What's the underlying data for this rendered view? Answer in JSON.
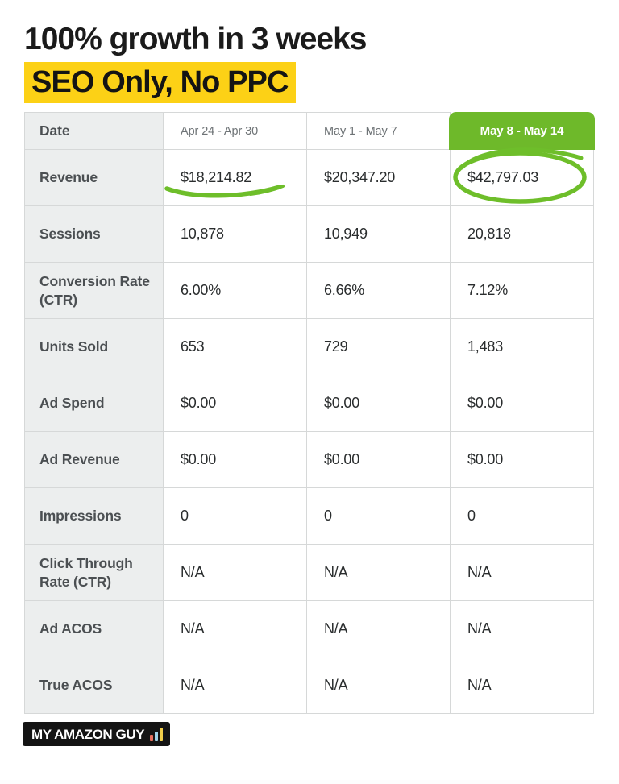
{
  "headline": {
    "line1": "100% growth in 3 weeks",
    "line2": "SEO Only, No PPC",
    "highlight_color": "#fcd116"
  },
  "table": {
    "label_column_header": "Date",
    "period_headers": [
      {
        "label": "Apr 24 - Apr 30",
        "highlighted": false
      },
      {
        "label": "May 1 - May 7",
        "highlighted": false
      },
      {
        "label": "May 8 - May 14",
        "highlighted": true
      }
    ],
    "highlight_color": "#6eb92a",
    "rows": [
      {
        "metric": "Revenue",
        "values": [
          "$18,214.82",
          "$20,347.20",
          "$42,797.03"
        ]
      },
      {
        "metric": "Sessions",
        "values": [
          "10,878",
          "10,949",
          "20,818"
        ]
      },
      {
        "metric": "Conversion Rate (CTR)",
        "values": [
          "6.00%",
          "6.66%",
          "7.12%"
        ]
      },
      {
        "metric": "Units Sold",
        "values": [
          "653",
          "729",
          "1,483"
        ]
      },
      {
        "metric": "Ad Spend",
        "values": [
          "$0.00",
          "$0.00",
          "$0.00"
        ]
      },
      {
        "metric": "Ad Revenue",
        "values": [
          "$0.00",
          "$0.00",
          "$0.00"
        ]
      },
      {
        "metric": "Impressions",
        "values": [
          "0",
          "0",
          "0"
        ]
      },
      {
        "metric": "Click Through Rate (CTR)",
        "values": [
          "N/A",
          "N/A",
          "N/A"
        ]
      },
      {
        "metric": "Ad ACOS",
        "values": [
          "N/A",
          "N/A",
          "N/A"
        ]
      },
      {
        "metric": "True ACOS",
        "values": [
          "N/A",
          "N/A",
          "N/A"
        ]
      }
    ]
  },
  "annotations": {
    "underline_target": "$18,214.82",
    "circle_target": "$42,797.03",
    "ink_color": "#6ebe2a"
  },
  "logo": {
    "text": "MY AMAZON GUY",
    "bar_colors": [
      "#e8705f",
      "#9fd2e8",
      "#f2cf4a"
    ]
  },
  "chart_data": {
    "type": "table",
    "title": "100% growth in 3 weeks — SEO Only, No PPC",
    "categories": [
      "Apr 24 - Apr 30",
      "May 1 - May 7",
      "May 8 - May 14"
    ],
    "series": [
      {
        "name": "Revenue",
        "values": [
          18214.82,
          20347.2,
          42797.03
        ]
      },
      {
        "name": "Sessions",
        "values": [
          10878,
          10949,
          20818
        ]
      },
      {
        "name": "Conversion Rate (CTR)",
        "values": [
          6.0,
          6.66,
          7.12
        ]
      },
      {
        "name": "Units Sold",
        "values": [
          653,
          729,
          1483
        ]
      },
      {
        "name": "Ad Spend",
        "values": [
          0.0,
          0.0,
          0.0
        ]
      },
      {
        "name": "Ad Revenue",
        "values": [
          0.0,
          0.0,
          0.0
        ]
      },
      {
        "name": "Impressions",
        "values": [
          0,
          0,
          0
        ]
      },
      {
        "name": "Click Through Rate (CTR)",
        "values": [
          null,
          null,
          null
        ]
      },
      {
        "name": "Ad ACOS",
        "values": [
          null,
          null,
          null
        ]
      },
      {
        "name": "True ACOS",
        "values": [
          null,
          null,
          null
        ]
      }
    ],
    "xlabel": "Date",
    "ylabel": "",
    "highlighted_category": "May 8 - May 14",
    "annotated_values": [
      18214.82,
      42797.03
    ]
  }
}
